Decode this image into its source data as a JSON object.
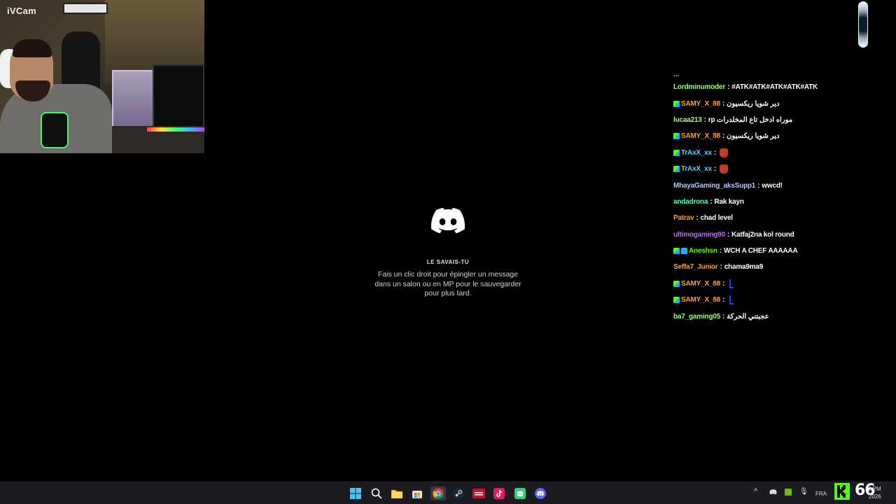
{
  "webcam": {
    "label": "iVCam"
  },
  "discord_loading": {
    "tip_heading": "LE SAVAIS-TU",
    "tip_body_line1": "Fais un clic droit pour épingler un message",
    "tip_body_line2": "dans un salon ou en MP pour le sauvegarder",
    "tip_body_line3": "pour plus tard."
  },
  "chat": {
    "cut_line": "...",
    "messages": [
      {
        "user": "Lordminumoder",
        "color": "#9dff6a",
        "badge": false,
        "msg": "#ATK#ATK#ATK#ATK#ATK"
      },
      {
        "user": "SAMY_X_88",
        "color": "#ff9f2e",
        "badge": true,
        "msg": "دير شويا ريكسيون"
      },
      {
        "user": "lucaa213",
        "color": "#9dff6a",
        "badge": false,
        "msg": "rp موراه ادخل تاع المخلدرات"
      },
      {
        "user": "SAMY_X_88",
        "color": "#ff9f2e",
        "badge": true,
        "msg": "دير شويا ريكسيون"
      },
      {
        "user": "TrAxX_xx",
        "color": "#4fd6ff",
        "badge": true,
        "msg": "",
        "emote": "red"
      },
      {
        "user": "TrAxX_xx",
        "color": "#4fd6ff",
        "badge": true,
        "msg": "",
        "emote": "red"
      },
      {
        "user": "MhayaGaming_aksSupp1",
        "color": "#b9c6ff",
        "badge": false,
        "msg": "wwcd!"
      },
      {
        "user": "andadrona",
        "color": "#5fffb0",
        "badge": false,
        "msg": "Rak kayn"
      },
      {
        "user": "Patrav",
        "color": "#ff9f2e",
        "badge": false,
        "msg": "chad level"
      },
      {
        "user": "ultimogaming90",
        "color": "#c26bff",
        "badge": false,
        "msg": "Katfaj2na kol round"
      },
      {
        "user": "Aneshsn",
        "color": "#53fc18",
        "badge": true,
        "badge2": true,
        "msg": "WCH A CHEF AAAAAA"
      },
      {
        "user": "Seffa7_Junior",
        "color": "#ff9f2e",
        "badge": false,
        "msg": "chama9ma9"
      },
      {
        "user": "SAMY_X_88",
        "color": "#ff9f2e",
        "badge": true,
        "msg": "",
        "emote": "blue"
      },
      {
        "user": "SAMY_X_88",
        "color": "#ff9f2e",
        "badge": true,
        "msg": "",
        "emote": "blue"
      },
      {
        "user": "ba7_gaming05",
        "color": "#9dff6a",
        "badge": false,
        "msg": "عجبتني الحركة"
      }
    ]
  },
  "taskbar": {
    "icons": [
      "windows-start-icon",
      "search-icon",
      "file-explorer-icon",
      "microsoft-store-icon",
      "chrome-icon",
      "steam-icon",
      "voice-app-icon",
      "tiktok-icon",
      "kick-icon",
      "discord-icon"
    ],
    "language": "FRA",
    "viewer_count": "66",
    "time": "0 PM",
    "date": "2026"
  }
}
